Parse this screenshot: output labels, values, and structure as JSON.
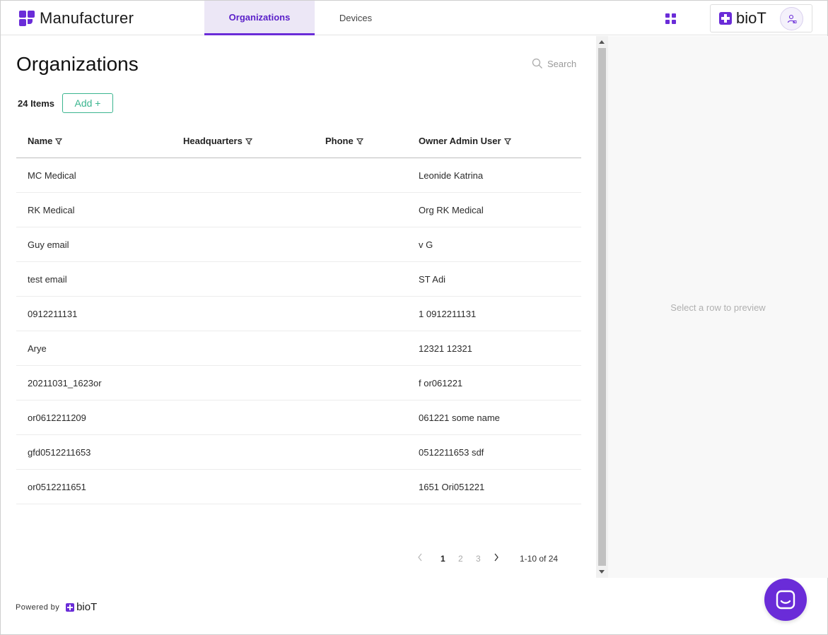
{
  "header": {
    "brand": "Manufacturer",
    "tabs": [
      {
        "label": "Organizations",
        "active": true
      },
      {
        "label": "Devices",
        "active": false
      }
    ],
    "logo_text": "bioT"
  },
  "main": {
    "title": "Organizations",
    "search_placeholder": "Search",
    "item_count": "24 Items",
    "add_label": "Add +",
    "columns": [
      "Name",
      "Headquarters",
      "Phone",
      "Owner Admin User"
    ],
    "rows": [
      {
        "name": "MC Medical",
        "headquarters": "",
        "phone": "",
        "owner": "Leonide Katrina"
      },
      {
        "name": "RK Medical",
        "headquarters": "",
        "phone": "",
        "owner": "Org RK Medical"
      },
      {
        "name": "Guy email",
        "headquarters": "",
        "phone": "",
        "owner": "v G"
      },
      {
        "name": "test email",
        "headquarters": "",
        "phone": "",
        "owner": "ST Adi"
      },
      {
        "name": "0912211131",
        "headquarters": "",
        "phone": "",
        "owner": "1 0912211131"
      },
      {
        "name": "Arye",
        "headquarters": "",
        "phone": "",
        "owner": "12321 12321"
      },
      {
        "name": "20211031_1623or",
        "headquarters": "",
        "phone": "",
        "owner": "f or061221"
      },
      {
        "name": "or0612211209",
        "headquarters": "",
        "phone": "",
        "owner": "061221 some name"
      },
      {
        "name": "gfd0512211653",
        "headquarters": "",
        "phone": "",
        "owner": "0512211653 sdf"
      },
      {
        "name": "or0512211651",
        "headquarters": "",
        "phone": "",
        "owner": "1651 Ori051221"
      }
    ],
    "pagination": {
      "pages": [
        "1",
        "2",
        "3"
      ],
      "current": "1",
      "range": "1-10 of 24"
    }
  },
  "preview": {
    "empty_text": "Select a row to preview"
  },
  "footer": {
    "powered_by": "Powered by",
    "logo_text": "bioT"
  },
  "colors": {
    "accent": "#6a2cd8",
    "add_button": "#3bb58f"
  }
}
